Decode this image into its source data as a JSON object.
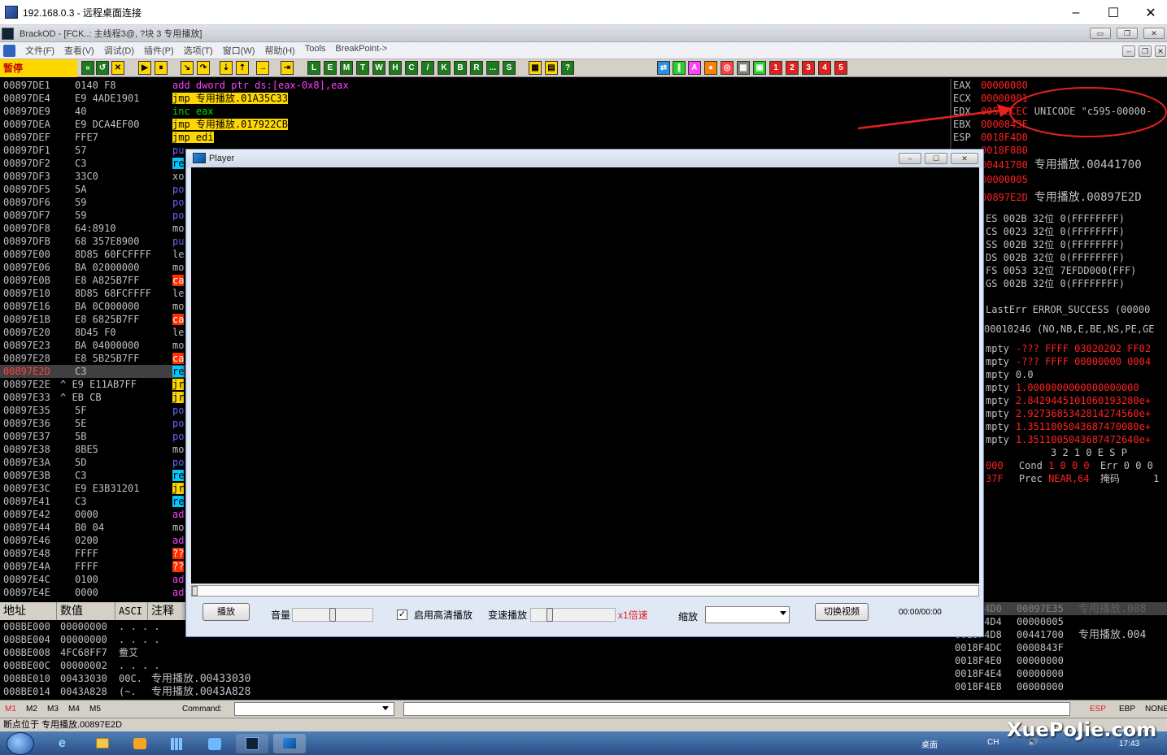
{
  "rdp": {
    "title": "192.168.0.3 - 远程桌面连接",
    "minimize": "–",
    "maximize": "☐",
    "close": "✕"
  },
  "od": {
    "title": "BrackOD - [FCK..: 主线程3@, ?块 3 专用播放]"
  },
  "menu": [
    "文件(F)",
    "查看(V)",
    "调试(D)",
    "插件(P)",
    "选项(T)",
    "窗口(W)",
    "帮助(H)",
    "Tools",
    "BreakPoint->"
  ],
  "toolbar": {
    "pause_label": "暂停",
    "letters": [
      "L",
      "E",
      "M",
      "T",
      "W",
      "H",
      "C",
      "/",
      "K",
      "B",
      "R",
      "...",
      "S"
    ],
    "extra": [
      "?"
    ]
  },
  "disasm": [
    {
      "a": "00897DE1",
      "h": "0140 F8",
      "asm": "add dword ptr ds:[eax-0x8],eax"
    },
    {
      "a": "00897DE4",
      "h": "E9 4ADE1901",
      "asm": "jmp 专用播放.01A35C33"
    },
    {
      "a": "00897DE9",
      "h": "40",
      "asm": "inc eax"
    },
    {
      "a": "00897DEA",
      "h": "E9 DCA4EF00",
      "asm": "jmp 专用播放.017922CB"
    },
    {
      "a": "00897DEF",
      "h": "FFE7",
      "asm": "jmp edi"
    },
    {
      "a": "00897DF1",
      "h": "57",
      "asm": "pu"
    },
    {
      "a": "00897DF2",
      "h": "C3",
      "asm": "re"
    },
    {
      "a": "00897DF3",
      "h": "33C0",
      "asm": "xo"
    },
    {
      "a": "00897DF5",
      "h": "5A",
      "asm": "po"
    },
    {
      "a": "00897DF6",
      "h": "59",
      "asm": "po"
    },
    {
      "a": "00897DF7",
      "h": "59",
      "asm": "po"
    },
    {
      "a": "00897DF8",
      "h": "64:8910",
      "asm": "mo"
    },
    {
      "a": "00897DFB",
      "h": "68 357E8900",
      "asm": "pu"
    },
    {
      "a": "00897E00",
      "h": "8D85 60FCFFFF",
      "asm": "le"
    },
    {
      "a": "00897E06",
      "h": "BA 02000000",
      "asm": "mo"
    },
    {
      "a": "00897E0B",
      "h": "E8 A825B7FF",
      "asm": "ca"
    },
    {
      "a": "00897E10",
      "h": "8D85 68FCFFFF",
      "asm": "le"
    },
    {
      "a": "00897E16",
      "h": "BA 0C000000",
      "asm": "mo"
    },
    {
      "a": "00897E1B",
      "h": "E8 6825B7FF",
      "asm": "ca"
    },
    {
      "a": "00897E20",
      "h": "8D45 F0",
      "asm": "le"
    },
    {
      "a": "00897E23",
      "h": "BA 04000000",
      "asm": "mo"
    },
    {
      "a": "00897E28",
      "h": "E8 5B25B7FF",
      "asm": "ca"
    },
    {
      "a": "00897E2D",
      "h": "C3",
      "asm": "re"
    },
    {
      "a": "00897E2E",
      "h": "^ E9 E11AB7FF",
      "asm": "jr"
    },
    {
      "a": "00897E33",
      "h": "^ EB CB",
      "asm": "jr"
    },
    {
      "a": "00897E35",
      "h": "5F",
      "asm": "po"
    },
    {
      "a": "00897E36",
      "h": "5E",
      "asm": "po"
    },
    {
      "a": "00897E37",
      "h": "5B",
      "asm": "po"
    },
    {
      "a": "00897E38",
      "h": "8BE5",
      "asm": "mo"
    },
    {
      "a": "00897E3A",
      "h": "5D",
      "asm": "po"
    },
    {
      "a": "00897E3B",
      "h": "C3",
      "asm": "re"
    },
    {
      "a": "00897E3C",
      "h": "E9 E3B31201",
      "asm": "jr"
    },
    {
      "a": "00897E41",
      "h": "C3",
      "asm": "re"
    },
    {
      "a": "00897E42",
      "h": "0000",
      "asm": "ad"
    },
    {
      "a": "00897E44",
      "h": "B0 04",
      "asm": "mo"
    },
    {
      "a": "00897E46",
      "h": "0200",
      "asm": "ad"
    },
    {
      "a": "00897E48",
      "h": "FFFF",
      "asm": "??"
    },
    {
      "a": "00897E4A",
      "h": "FFFF",
      "asm": "??"
    },
    {
      "a": "00897E4C",
      "h": "0100",
      "asm": "ad"
    },
    {
      "a": "00897E4E",
      "h": "0000",
      "asm": "ad"
    }
  ],
  "registers": [
    {
      "n": "EAX",
      "v": "00000000",
      "c": ""
    },
    {
      "n": "ECX",
      "v": "00000001",
      "c": ""
    },
    {
      "n": "EDX",
      "v": "0051ECEC",
      "c": "UNICODE \"c595-00000-"
    },
    {
      "n": "EBX",
      "v": "0000843F",
      "c": ""
    },
    {
      "n": "ESP",
      "v": "0018F4D0",
      "c": ""
    },
    {
      "n": "",
      "v": "0018F880",
      "c": ""
    },
    {
      "n": "",
      "v": "00441700",
      "c": "专用播放.00441700"
    },
    {
      "n": "",
      "v": "00000005",
      "c": ""
    },
    {
      "n": "",
      "v": "",
      "c": ""
    },
    {
      "n": "",
      "v": "00897E2D",
      "c": "专用播放.00897E2D"
    }
  ],
  "segments": [
    "ES 002B 32位 0(FFFFFFFF)",
    "CS 0023 32位 0(FFFFFFFF)",
    "SS 002B 32位 0(FFFFFFFF)",
    "DS 002B 32位 0(FFFFFFFF)",
    "FS 0053 32位 7EFDD000(FFF)",
    "GS 002B 32位 0(FFFFFFFF)"
  ],
  "lasterr": "LastErr ERROR_SUCCESS (00000",
  "eflags": "00010246 (NO,NB,E,BE,NS,PE,GE",
  "fpu": [
    {
      "l": "mpty",
      "v": "-??? FFFF 03020202 FF02"
    },
    {
      "l": "mpty",
      "v": "-??? FFFF 00000000 0004"
    },
    {
      "l": "mpty",
      "v": "0.0"
    },
    {
      "l": "mpty",
      "v": "1.0000000000000000000"
    },
    {
      "l": "mpty",
      "v": "2.8429445101060193280e+"
    },
    {
      "l": "mpty",
      "v": "2.9273685342814274560e+"
    },
    {
      "l": "mpty",
      "v": "1.3511005043687470080e+"
    },
    {
      "l": "mpty",
      "v": "1.3511005043687472640e+"
    }
  ],
  "fpu_flags": {
    "hdr": "3 2 1 0      E S P",
    "cond_lbl": "Cond",
    "cond": "1 0 0 0",
    "err": "Err 0 0 0",
    "prec_lbl": "Prec",
    "prec": "NEAR,64",
    "mask": "掩码",
    "r1": "000",
    "r2": "37F",
    "one": "1"
  },
  "dump": {
    "headers": [
      "地址",
      "数值",
      "ASCI",
      "注释"
    ],
    "rows": [
      {
        "a": "008BE000",
        "v": "00000000",
        "s": ". . . .",
        "c": ""
      },
      {
        "a": "008BE004",
        "v": "00000000",
        "s": ". . . .",
        "c": ""
      },
      {
        "a": "008BE008",
        "v": "4FC68FF7",
        "s": "鲞艾",
        "c": ""
      },
      {
        "a": "008BE00C",
        "v": "00000002",
        "s": ". . . .",
        "c": ""
      },
      {
        "a": "008BE010",
        "v": "00433030",
        "s": "00C.",
        "c": "专用播放.00433030"
      },
      {
        "a": "008BE014",
        "v": "0043A828",
        "s": "(~.",
        "c": "专用播放.0043A828"
      }
    ]
  },
  "stack": [
    {
      "a": "0018F4D0",
      "v": "00897E35",
      "c": "专用播放.008"
    },
    {
      "a": "0018F4D4",
      "v": "00000005",
      "c": ""
    },
    {
      "a": "0018F4D8",
      "v": "00441700",
      "c": "专用播放.004"
    },
    {
      "a": "0018F4DC",
      "v": "0000843F",
      "c": ""
    },
    {
      "a": "0018F4E0",
      "v": "00000000",
      "c": ""
    },
    {
      "a": "0018F4E4",
      "v": "00000000",
      "c": ""
    },
    {
      "a": "0018F4E8",
      "v": "00000000",
      "c": ""
    }
  ],
  "cmdbar": {
    "m": [
      "M1",
      "M2",
      "M3",
      "M4",
      "M5"
    ],
    "command_label": "Command:",
    "esp": "ESP",
    "ebp": "EBP",
    "none": "NONE"
  },
  "status": "断点位于 专用播放.00897E2D",
  "player": {
    "title": "Player",
    "play": "播放",
    "volume": "音量",
    "volume_level": 0.49,
    "hq_label": "启用高清播放",
    "hq_checked": true,
    "speed_label": "变速播放",
    "speed_level": 0.2,
    "speed_value": "x1倍速",
    "zoom_label": "缩放",
    "switch": "切换视频",
    "time": "00:00/00:00",
    "progress": 0
  },
  "taskbar": {
    "desktop": "桌面",
    "lang": "CH",
    "time": "17:43",
    "watermark": "XuePoJie.com"
  },
  "colors": {
    "accent_red": "#ff2020",
    "asm_add": "#ff40ff",
    "asm_jmp_bg": "#ffd700",
    "asm_call_bg": "#ff4000",
    "asm_ret_bg": "#00c0ff",
    "asm_push_fg": "#6060ff"
  }
}
